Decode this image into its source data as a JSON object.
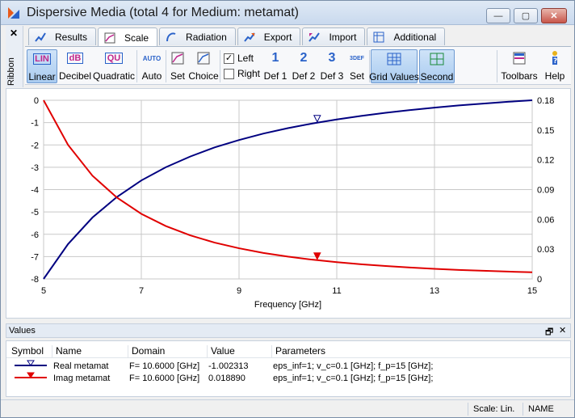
{
  "window": {
    "title": "Dispersive Media (total 4 for Medium: metamat)",
    "buttons": {
      "minimize": "—",
      "maximize": "▢",
      "close": "✕"
    }
  },
  "ribbon": {
    "close": "✕",
    "label": "Ribbon"
  },
  "tabs": [
    {
      "label": "Results",
      "icon": "results-icon"
    },
    {
      "label": "Scale",
      "icon": "scale-icon",
      "active": true
    },
    {
      "label": "Radiation",
      "icon": "radiation-icon"
    },
    {
      "label": "Export",
      "icon": "export-icon"
    },
    {
      "label": "Import",
      "icon": "import-icon"
    },
    {
      "label": "Additional",
      "icon": "additional-icon"
    }
  ],
  "toolbar": {
    "linear": {
      "label": "Linear",
      "icon_text": "LIN"
    },
    "decibel": {
      "label": "Decibel",
      "icon_text": "dB"
    },
    "quadratic": {
      "label": "Quadratic",
      "icon_text": "QU"
    },
    "auto": {
      "label": "Auto",
      "icon_text": "AUTO"
    },
    "set": {
      "label": "Set"
    },
    "choice": {
      "label": "Choice"
    },
    "left": {
      "label": "Left",
      "checked": true
    },
    "right": {
      "label": "Right",
      "checked": false
    },
    "def1": {
      "label": "Def 1",
      "icon_text": "1"
    },
    "def2": {
      "label": "Def 2",
      "icon_text": "2"
    },
    "def3": {
      "label": "Def 3",
      "icon_text": "3"
    },
    "set2": {
      "label": "Set",
      "icon_text": "3DEF"
    },
    "grid_values": {
      "label": "Grid Values"
    },
    "second": {
      "label": "Second"
    },
    "toolbars": {
      "label": "Toolbars"
    },
    "help": {
      "label": "Help"
    }
  },
  "chart_data": {
    "type": "line",
    "xlabel": "Frequency [GHz]",
    "xlim": [
      5,
      15
    ],
    "x_ticks": [
      5,
      7,
      9,
      11,
      13,
      15
    ],
    "y_left_lim": [
      -8,
      0
    ],
    "y_left_ticks": [
      0,
      -1,
      -2,
      -3,
      -4,
      -5,
      -6,
      -7,
      -8
    ],
    "y_right_lim": [
      0,
      0.18
    ],
    "y_right_ticks": [
      0.18,
      0.15,
      0.12,
      0.09,
      0.06,
      0.03,
      0
    ],
    "grid": true,
    "marker_x": 10.6,
    "series": [
      {
        "name": "Real metamat",
        "axis": "left",
        "color": "#000080",
        "x": [
          5,
          5.5,
          6,
          6.5,
          7,
          7.5,
          8,
          8.5,
          9,
          9.5,
          10,
          10.5,
          11,
          11.5,
          12,
          12.5,
          13,
          13.5,
          14,
          14.5,
          15
        ],
        "y": [
          -8.0,
          -6.44,
          -5.25,
          -4.33,
          -3.59,
          -3.0,
          -2.52,
          -2.11,
          -1.78,
          -1.49,
          -1.25,
          -1.04,
          -0.86,
          -0.7,
          -0.56,
          -0.44,
          -0.33,
          -0.23,
          -0.15,
          -0.07,
          0.0
        ]
      },
      {
        "name": "Imag metamat",
        "axis": "right",
        "color": "#e00000",
        "x": [
          5,
          5.5,
          6,
          6.5,
          7,
          7.5,
          8,
          8.5,
          9,
          9.5,
          10,
          10.5,
          11,
          11.5,
          12,
          12.5,
          13,
          13.5,
          14,
          14.5,
          15
        ],
        "y": [
          0.18,
          0.135,
          0.104,
          0.082,
          0.0656,
          0.0533,
          0.0439,
          0.0366,
          0.0309,
          0.0262,
          0.0225,
          0.0194,
          0.0169,
          0.0148,
          0.013,
          0.0115,
          0.0102,
          0.0091,
          0.0082,
          0.0074,
          0.0067
        ]
      }
    ]
  },
  "values_panel": {
    "title": "Values",
    "buttons": {
      "float": "🗗",
      "close": "✕"
    },
    "columns": [
      "Symbol",
      "Name",
      "Domain",
      "Value",
      "Parameters"
    ],
    "rows": [
      {
        "name": "Real metamat",
        "domain": "F= 10.6000 [GHz]",
        "value": "-1.002313",
        "parameters": "eps_inf=1; v_c=0.1 [GHz]; f_p=15 [GHz];",
        "color": "#000080",
        "marker": "open-triangle"
      },
      {
        "name": "Imag metamat",
        "domain": "F= 10.6000 [GHz]",
        "value": "0.018890",
        "parameters": "eps_inf=1; v_c=0.1 [GHz]; f_p=15 [GHz];",
        "color": "#e00000",
        "marker": "filled-triangle"
      }
    ]
  },
  "status": {
    "scale": "Scale: Lin.",
    "name": "NAME"
  }
}
